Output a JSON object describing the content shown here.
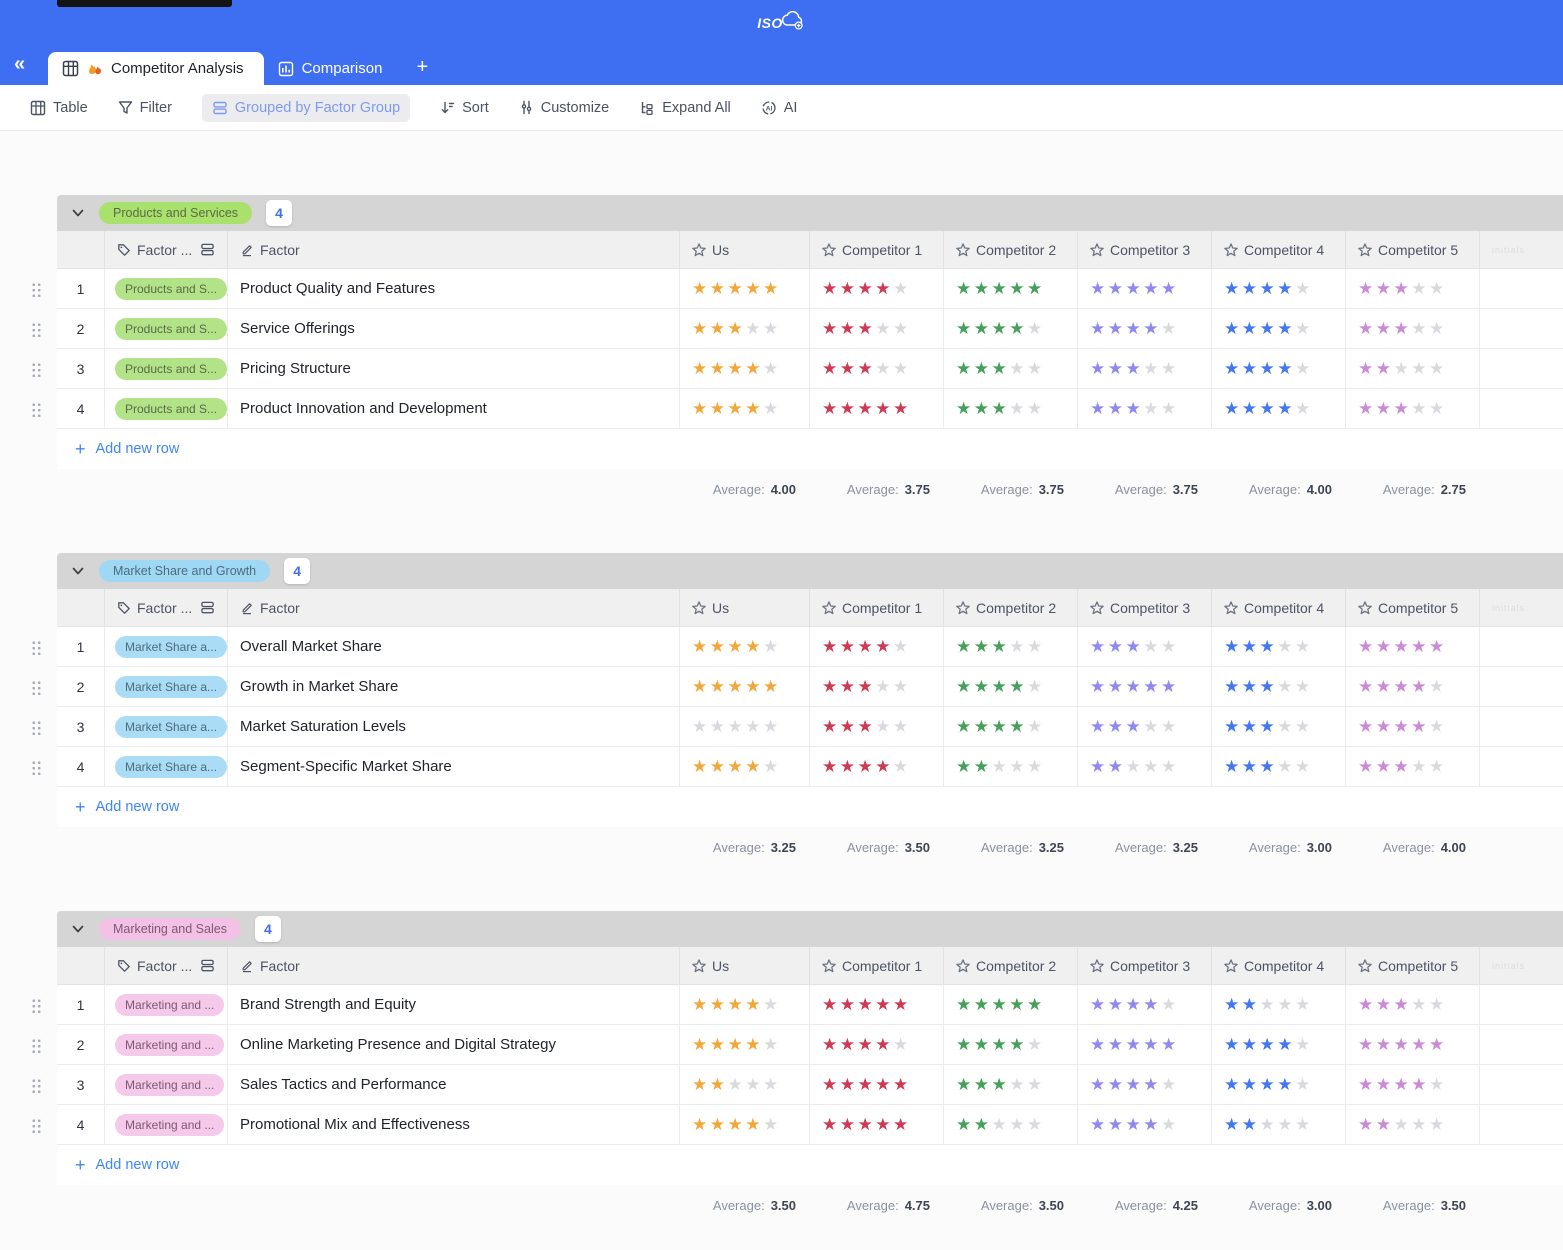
{
  "topbar": {
    "logo": "ISO"
  },
  "tab_bar": {
    "collapse_icon": "«",
    "tabs": [
      {
        "label": "Competitor Analysis",
        "active": true
      },
      {
        "label": "Comparison",
        "active": false
      }
    ],
    "add_tab": "+"
  },
  "toolbar": {
    "items": [
      {
        "label": "Table"
      },
      {
        "label": "Filter"
      },
      {
        "label": "Grouped by Factor Group",
        "active": true
      },
      {
        "label": "Sort"
      },
      {
        "label": "Customize"
      },
      {
        "label": "Expand All"
      },
      {
        "label": "AI"
      }
    ]
  },
  "columns": {
    "factor_group": "Factor ...",
    "factor": "Factor",
    "ratings": [
      "Us",
      "Competitor 1",
      "Competitor 2",
      "Competitor 3",
      "Competitor 4",
      "Competitor 5"
    ]
  },
  "extra_column": {
    "header_text": "initials"
  },
  "rating_colors": [
    "#f2a73a",
    "#ce3a54",
    "#44a05a",
    "#9088f0",
    "#4377f0",
    "#ca8ad6"
  ],
  "star_empty_color": "#d8dade",
  "average_label": "Average:",
  "add_row": {
    "plus": "+",
    "label": "Add new row"
  },
  "groups": [
    {
      "name": "Products and Services",
      "count": "4",
      "row_tag": "Products and S...",
      "colors": {
        "band_pill_bg": "#a9e16c",
        "row_pill_bg": "#b2e388",
        "pill_text": "#5c6a49"
      },
      "rows": [
        {
          "num": "1",
          "factor": "Product Quality and Features",
          "ratings": [
            5,
            4,
            5,
            5,
            4,
            3
          ]
        },
        {
          "num": "2",
          "factor": "Service Offerings",
          "ratings": [
            3,
            3,
            4,
            4,
            4,
            3
          ]
        },
        {
          "num": "3",
          "factor": "Pricing Structure",
          "ratings": [
            4,
            3,
            3,
            3,
            4,
            2
          ]
        },
        {
          "num": "4",
          "factor": "Product Innovation and Development",
          "ratings": [
            4,
            5,
            3,
            3,
            4,
            3
          ]
        }
      ],
      "averages": [
        "4.00",
        "3.75",
        "3.75",
        "3.75",
        "4.00",
        "2.75"
      ]
    },
    {
      "name": "Market Share and Growth",
      "count": "4",
      "row_tag": "Market Share a...",
      "colors": {
        "band_pill_bg": "#9fd8f5",
        "row_pill_bg": "#aadcf6",
        "pill_text": "#4d6b7c"
      },
      "rows": [
        {
          "num": "1",
          "factor": "Overall Market Share",
          "ratings": [
            4,
            4,
            3,
            3,
            3,
            5
          ]
        },
        {
          "num": "2",
          "factor": "Growth in Market Share",
          "ratings": [
            5,
            3,
            4,
            5,
            3,
            4
          ]
        },
        {
          "num": "3",
          "factor": "Market Saturation Levels",
          "ratings": [
            0,
            3,
            4,
            3,
            3,
            4
          ]
        },
        {
          "num": "4",
          "factor": "Segment-Specific Market Share",
          "ratings": [
            4,
            4,
            2,
            2,
            3,
            3
          ]
        }
      ],
      "averages": [
        "3.25",
        "3.50",
        "3.25",
        "3.25",
        "3.00",
        "4.00"
      ]
    },
    {
      "name": "Marketing and Sales",
      "count": "4",
      "row_tag": "Marketing and ...",
      "colors": {
        "band_pill_bg": "#f3c0e6",
        "row_pill_bg": "#f5c9ea",
        "pill_text": "#7c5a72"
      },
      "rows": [
        {
          "num": "1",
          "factor": "Brand Strength and Equity",
          "ratings": [
            4,
            5,
            5,
            4,
            2,
            3
          ]
        },
        {
          "num": "2",
          "factor": "Online Marketing Presence and Digital Strategy",
          "ratings": [
            4,
            4,
            4,
            5,
            4,
            5
          ]
        },
        {
          "num": "3",
          "factor": "Sales Tactics and Performance",
          "ratings": [
            2,
            5,
            3,
            4,
            4,
            4
          ]
        },
        {
          "num": "4",
          "factor": "Promotional Mix and Effectiveness",
          "ratings": [
            4,
            5,
            2,
            4,
            2,
            2
          ]
        }
      ],
      "averages": [
        "3.50",
        "4.75",
        "3.50",
        "4.25",
        "3.00",
        "3.50"
      ]
    }
  ]
}
